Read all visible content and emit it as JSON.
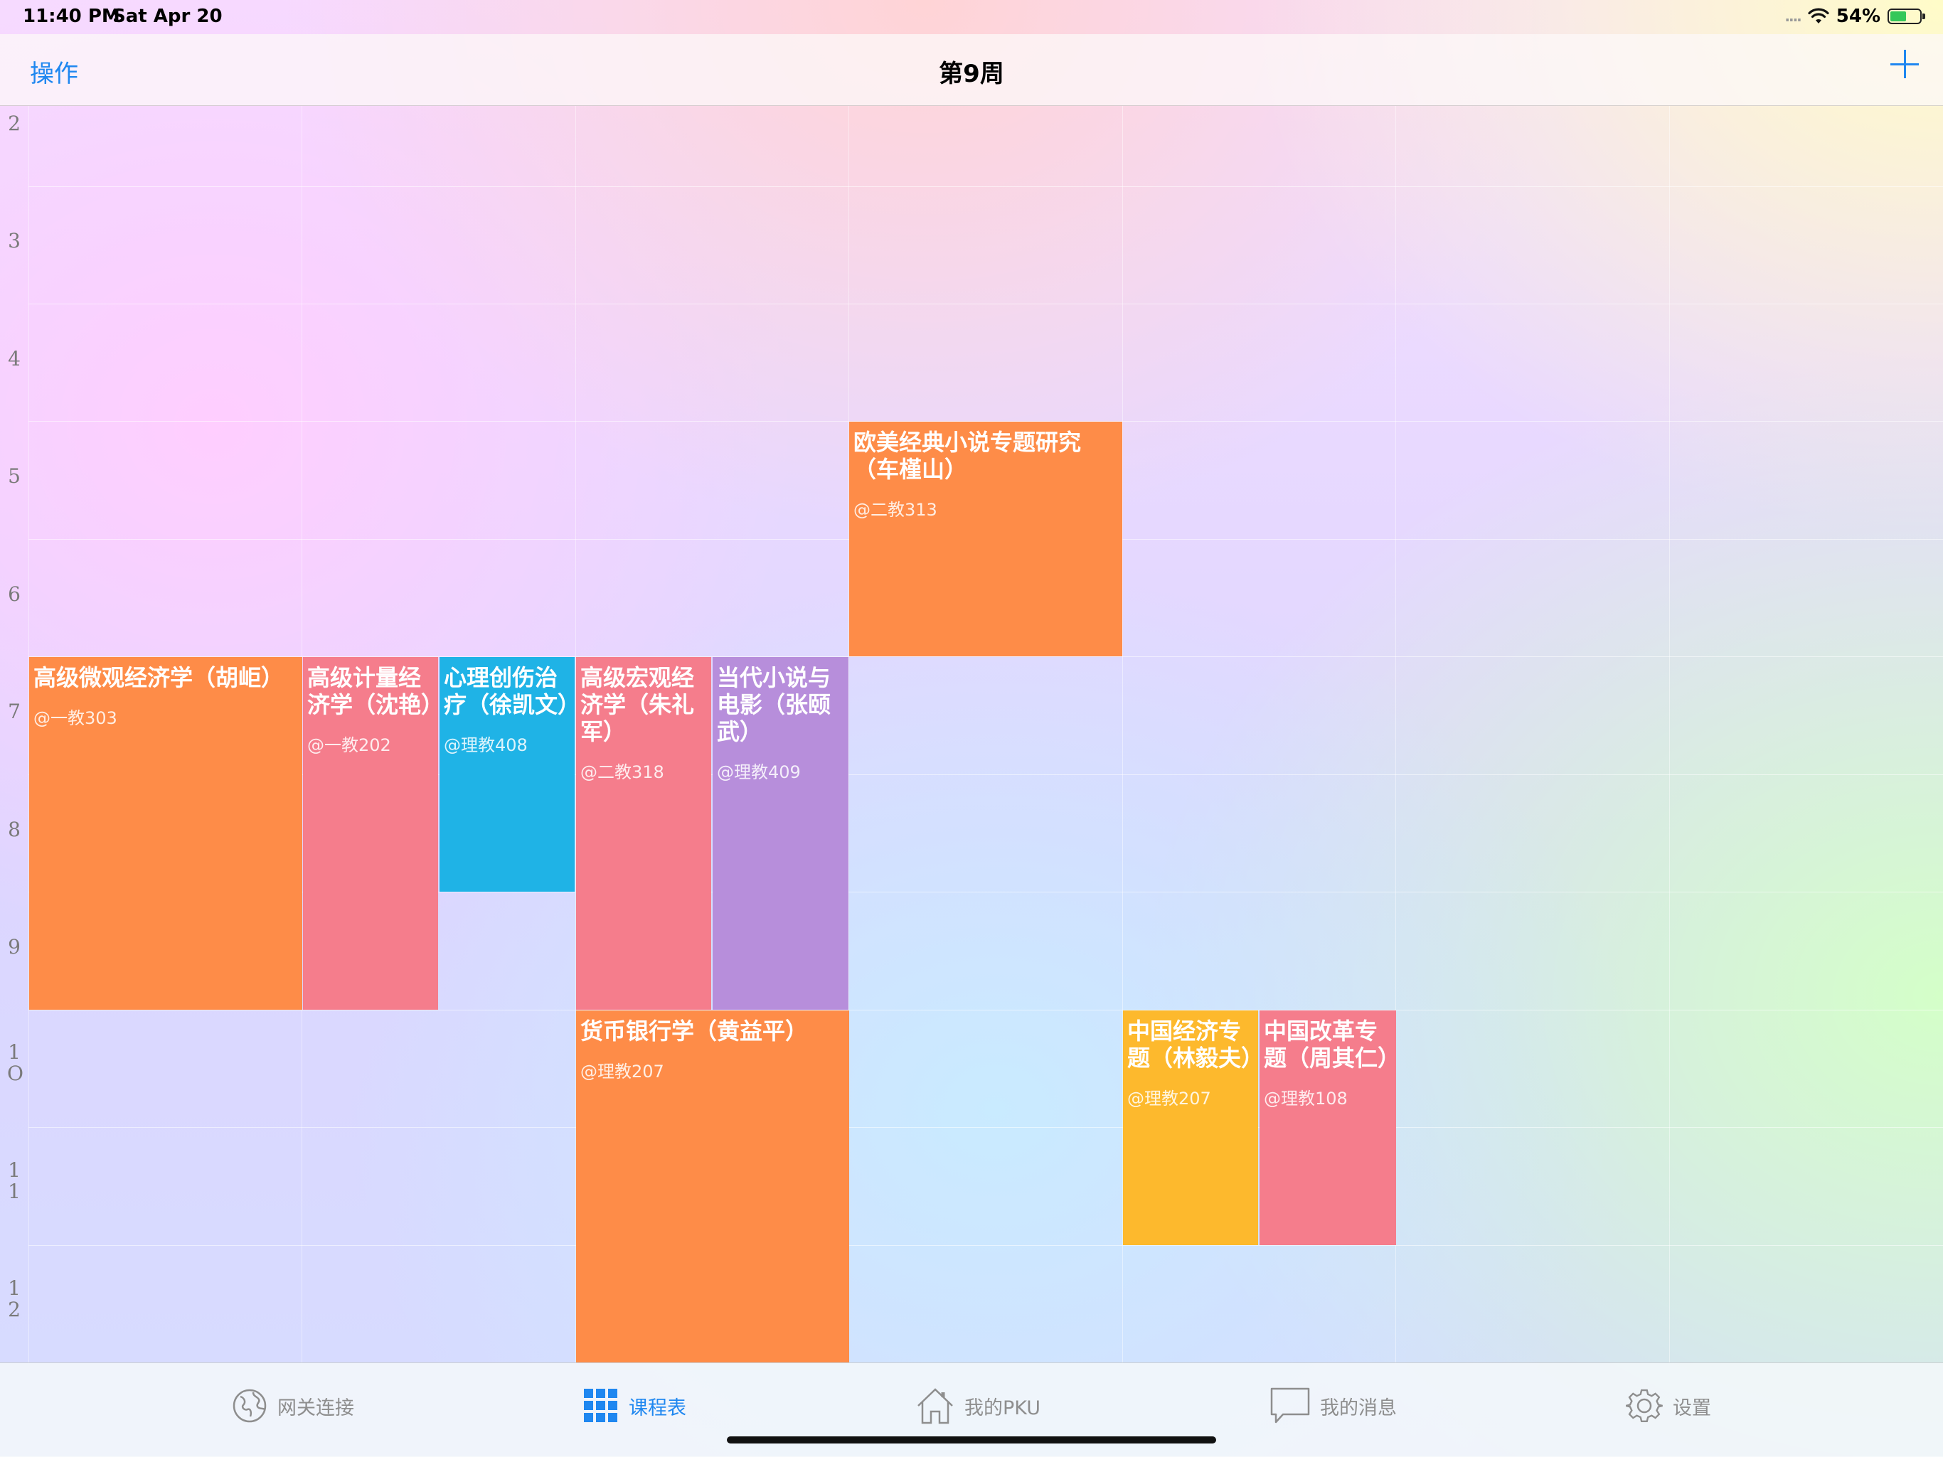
{
  "status": {
    "time": "11:40 PM",
    "date": "Sat Apr 20",
    "signal_dots": "....",
    "battery": "54%",
    "battery_level": 0.54
  },
  "nav": {
    "left_action": "操作",
    "title": "第9周",
    "add_icon": "plus-icon"
  },
  "hours": [
    "2",
    "3",
    "4",
    "5",
    "6",
    "7",
    "8",
    "9",
    "1\nO",
    "1\n1",
    "1\n2"
  ],
  "courses": [
    {
      "name": "欧美经典小说专题研究（车槿山）",
      "room": "@二教313",
      "color": "#fe8c48"
    },
    {
      "name": "高级微观经济学（胡岠）",
      "room": "@一教303",
      "color": "#fe8c48"
    },
    {
      "name": "高级计量经济学（沈艳）",
      "room": "@一教202",
      "color": "#f57d8c"
    },
    {
      "name": "心理创伤治疗（徐凯文）",
      "room": "@理教408",
      "color": "#1fb3e6"
    },
    {
      "name": "高级宏观经济学（朱礼军）",
      "room": "@二教318",
      "color": "#f57d8c"
    },
    {
      "name": "当代小说与电影（张颐武）",
      "room": "@理教409",
      "color": "#b78edb"
    },
    {
      "name": "货币银行学（黄益平）",
      "room": "@理教207",
      "color": "#fe8c48"
    },
    {
      "name": "中国经济专题（林毅夫）",
      "room": "@理教207",
      "color": "#fdb92d"
    },
    {
      "name": "中国改革专题（周其仁）",
      "room": "@理教108",
      "color": "#f57d8c"
    }
  ],
  "tabs": [
    {
      "label": "网关连接",
      "icon": "globe-icon",
      "active": false
    },
    {
      "label": "课程表",
      "icon": "grid-icon",
      "active": true
    },
    {
      "label": "我的PKU",
      "icon": "home-icon",
      "active": false
    },
    {
      "label": "我的消息",
      "icon": "chat-bubble-icon",
      "active": false
    },
    {
      "label": "设置",
      "icon": "gear-icon",
      "active": false
    }
  ],
  "colors": {
    "accent": "#1f87f0",
    "orange": "#fe8c48",
    "pink": "#f57d8c",
    "blue": "#1fb3e6",
    "purple": "#b78edb",
    "yellow": "#fdb92d"
  }
}
